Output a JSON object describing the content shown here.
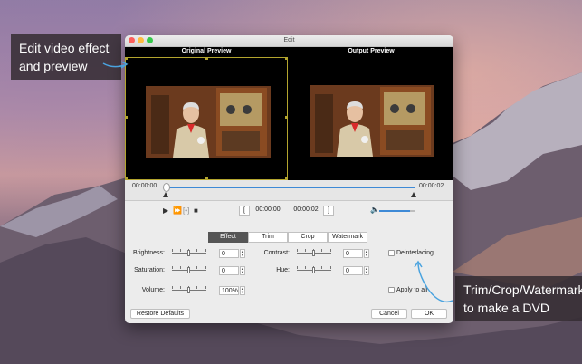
{
  "callouts": {
    "left": "Edit video effect and preview",
    "right": "Trim/Crop/Watermark to make a DVD"
  },
  "window": {
    "title": "Edit"
  },
  "preview": {
    "original_label": "Original Preview",
    "output_label": "Output Preview"
  },
  "timeline": {
    "start_time": "00:00:00",
    "end_time": "00:00:02",
    "progress_fraction": 1.0
  },
  "controls": {
    "play_icon": "play-icon",
    "next_frame_icon": "next-frame-icon",
    "snapshot_icon": "bracket-icon",
    "stop_icon": "stop-icon",
    "start_bracket": "[",
    "start_time": "00:00:00",
    "end_time": "00:00:02",
    "end_bracket": "]",
    "volume_icon": "speaker-icon",
    "volume_fraction": 0.85
  },
  "tabs": [
    "Effect",
    "Trim",
    "Crop",
    "Watermark"
  ],
  "active_tab": "Effect",
  "effect": {
    "brightness": {
      "label": "Brightness:",
      "value": "0"
    },
    "contrast": {
      "label": "Contrast:",
      "value": "0"
    },
    "saturation": {
      "label": "Saturation:",
      "value": "0"
    },
    "hue": {
      "label": "Hue:",
      "value": "0"
    },
    "volume": {
      "label": "Volume:",
      "value": "100%"
    },
    "deinterlacing_label": "Deinterlacing",
    "apply_to_all_label": "Apply to all"
  },
  "buttons": {
    "restore": "Restore Defaults",
    "cancel": "Cancel",
    "ok": "OK"
  },
  "colors": {
    "accent": "#3e8ad6",
    "selection_border": "#b3a52e",
    "active_tab": "#555555"
  }
}
